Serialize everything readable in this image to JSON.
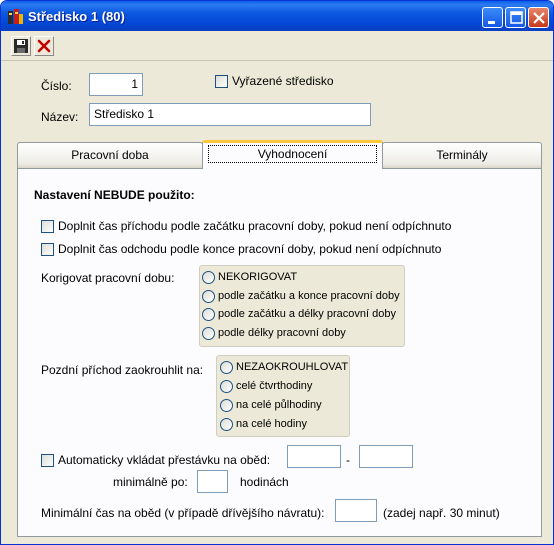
{
  "window": {
    "title": "Středisko 1 (80)",
    "buttons": {
      "minimize": "minimize",
      "maximize": "maximize",
      "close": "close"
    }
  },
  "toolbar": {
    "save_icon": "save-icon",
    "cancel_icon": "cancel-icon"
  },
  "form": {
    "cislo_label": "Číslo:",
    "cislo_value": "1",
    "excluded_label": "Vyřazené středisko",
    "nazev_label": "Název:",
    "nazev_value": "Středisko 1"
  },
  "tabs": [
    {
      "label": "Pracovní doba",
      "active": false
    },
    {
      "label": "Vyhodnocení",
      "active": true
    },
    {
      "label": "Terminály",
      "active": false
    }
  ],
  "evaluation": {
    "heading": "Nastavení NEBUDE použito:",
    "fill_arrival": "Doplnit čas příchodu podle začátku pracovní doby, pokud není odpíchnuto",
    "fill_departure": "Doplnit čas odchodu podle konce pracovní doby, pokud není odpíchnuto",
    "correct_label": "Korigovat pracovní dobu:",
    "correct_options": [
      "NEKORIGOVAT",
      "podle začátku a konce pracovní doby",
      "podle začátku a délky pracovní doby",
      "podle délky pracovní doby"
    ],
    "late_label": "Pozdní příchod zaokrouhlit na:",
    "late_options": [
      "NEZAOKROUHLOVAT",
      "celé čtvrthodiny",
      "na celé půlhodiny",
      "na celé hodiny"
    ],
    "auto_break_label": "Automaticky vkládat přestávku na oběd:",
    "dash": "-",
    "min_after_label": "minimálně po:",
    "hours_label": "hodinách",
    "min_lunch_label": "Minimální čas na oběd (v případě dřívějšího návratu):",
    "min_lunch_hint": "(zadej např. 30 minut)"
  },
  "colors": {
    "titlebar": "#0C58E0",
    "face": "#ECE9D8",
    "active_tab_accent": "#FFC83C"
  }
}
